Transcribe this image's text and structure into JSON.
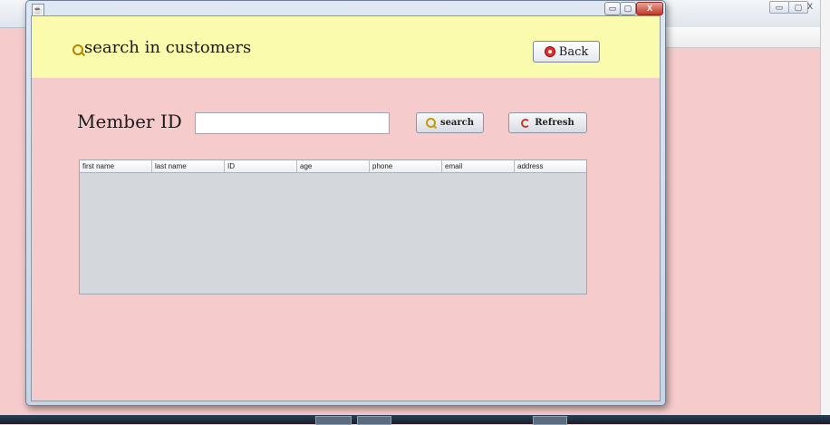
{
  "window": {
    "title": "",
    "controls": {
      "minimize": "▭",
      "maximize": "▢",
      "close": "X"
    }
  },
  "background_window": {
    "controls": {
      "minimize": "▭",
      "maximize": "▢",
      "close": "X"
    }
  },
  "header": {
    "title": "search in customers",
    "title_icon": "search-icon",
    "back_button": {
      "label": "Back",
      "icon": "back-icon"
    }
  },
  "search": {
    "label": "Member ID",
    "input_value": "",
    "search_button": {
      "label": "search",
      "icon": "magnifier-icon"
    },
    "refresh_button": {
      "label": "Refresh",
      "icon": "refresh-icon"
    }
  },
  "table": {
    "columns": [
      "first name",
      "last name",
      "ID",
      "age",
      "phone",
      "email",
      "address"
    ],
    "rows": []
  },
  "colors": {
    "page_background": "#f6cbcc",
    "header_background": "#fbfbad",
    "table_background": "#d4d7dc"
  }
}
